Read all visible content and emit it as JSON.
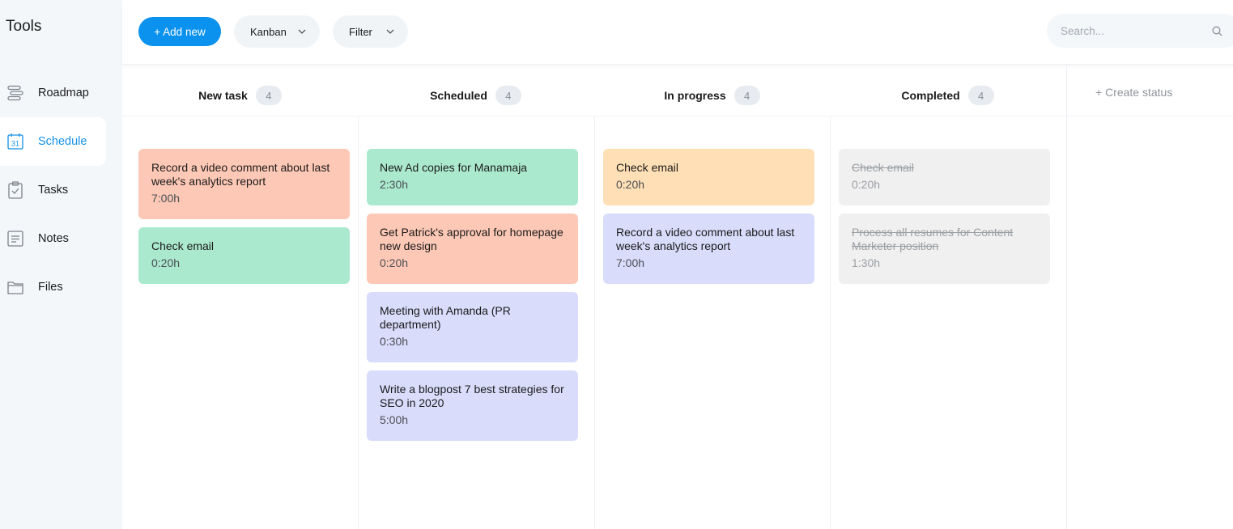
{
  "sidebar": {
    "title": "Tools",
    "items": [
      {
        "label": "Roadmap",
        "icon": "roadmap-icon",
        "active": false
      },
      {
        "label": "Schedule",
        "icon": "calendar-icon",
        "active": true,
        "icon_text": "31"
      },
      {
        "label": "Tasks",
        "icon": "clipboard-check-icon",
        "active": false
      },
      {
        "label": "Notes",
        "icon": "notes-icon",
        "active": false
      },
      {
        "label": "Files",
        "icon": "folder-icon",
        "active": false
      }
    ]
  },
  "toolbar": {
    "add_label": "+ Add new",
    "view_label": "Kanban",
    "filter_label": "Filter",
    "search_placeholder": "Search..."
  },
  "board": {
    "create_status_label": "+ Create status",
    "columns": [
      {
        "title": "New task",
        "count": "4",
        "cards": [
          {
            "title": "Record a video comment about last week's analytics report",
            "time": "7:00h",
            "color": "#fdc8b6",
            "done": false
          },
          {
            "title": "Check email",
            "time": "0:20h",
            "color": "#abe9cf",
            "done": false
          }
        ]
      },
      {
        "title": "Scheduled",
        "count": "4",
        "cards": [
          {
            "title": "New Ad copies for Manamaja",
            "time": "2:30h",
            "color": "#abe9cf",
            "done": false
          },
          {
            "title": "Get Patrick's approval for homepage new design",
            "time": "0:20h",
            "color": "#fdc8b6",
            "done": false
          },
          {
            "title": "Meeting with Amanda (PR department)",
            "time": "0:30h",
            "color": "#d9dcfb",
            "done": false
          },
          {
            "title": "Write a blogpost 7 best strategies for SEO in 2020",
            "time": "5:00h",
            "color": "#d9dcfb",
            "done": false
          }
        ]
      },
      {
        "title": "In progress",
        "count": "4",
        "cards": [
          {
            "title": "Check email",
            "time": "0:20h",
            "color": "#ffdfb5",
            "done": false
          },
          {
            "title": "Record a video comment about last week's analytics report",
            "time": "7:00h",
            "color": "#d9dcfb",
            "done": false
          }
        ]
      },
      {
        "title": "Completed",
        "count": "4",
        "cards": [
          {
            "title": "Check email",
            "time": "0:20h",
            "color": "#f0f0f0",
            "done": true
          },
          {
            "title": "Process all resumes for Content Marketer position",
            "time": "1:30h",
            "color": "#f0f0f0",
            "done": true
          }
        ]
      }
    ]
  },
  "colors": {
    "accent": "#0a92ee",
    "active_nav": "#1592e6"
  }
}
